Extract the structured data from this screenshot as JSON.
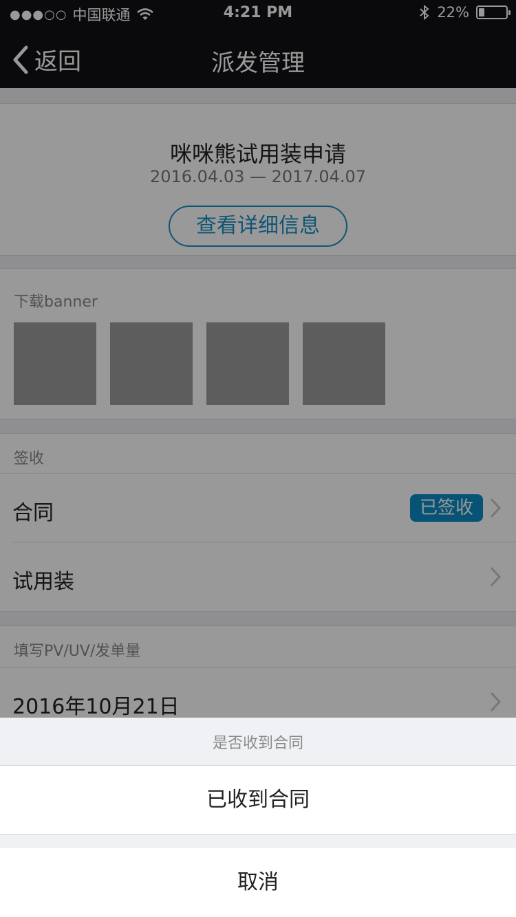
{
  "status_bar": {
    "signal": "●●●○○",
    "carrier": "中国联通",
    "time": "4:21 PM",
    "battery_percent": "22%",
    "battery_level": 0.22
  },
  "navbar": {
    "back_label": "返回",
    "title": "派发管理"
  },
  "event": {
    "title": "咪咪熊试用装申请",
    "dates": "2016.04.03 — 2017.04.07",
    "detail_button": "查看详细信息"
  },
  "banner": {
    "label": "下载banner",
    "thumbnail_count": 4
  },
  "sign": {
    "label": "签收",
    "rows": [
      {
        "label": "合同",
        "badge": "已签收"
      },
      {
        "label": "试用装"
      }
    ]
  },
  "pv": {
    "label": "填写PV/UV/发单量",
    "date_row": "2016年10月21日"
  },
  "action_sheet": {
    "title": "是否收到合同",
    "option": "已收到合同",
    "cancel": "取消"
  },
  "colors": {
    "accent": "#0c8ac4",
    "nav_bg": "#111214"
  }
}
